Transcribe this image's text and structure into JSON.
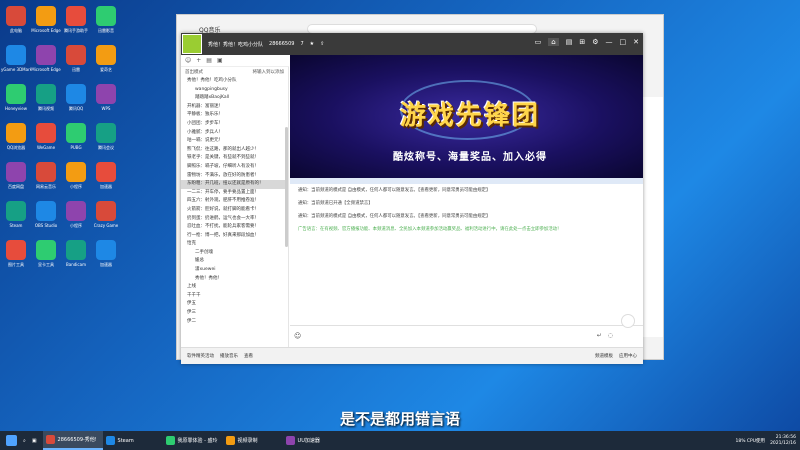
{
  "desktop": {
    "icons": [
      [
        "此电脑",
        "yGame 3DMark",
        "Honeyview",
        "QQ浏览器",
        "百度网盘",
        "Steam",
        "图片工具"
      ],
      [
        "Microsoft Edge",
        "Microsoft Edge",
        "腾讯视频",
        "WeGame",
        "网易云音乐",
        "OBS Studio",
        "显卡工具"
      ],
      [
        "腾讯手游助手",
        "迅雷",
        "腾讯QQ",
        "PUBG",
        "小程序",
        "小程序",
        "Bandicam"
      ],
      [
        "迅雷影音",
        "爱奇艺",
        "WPS",
        "腾讯会议",
        "加速器",
        "Crazy Game",
        "加速器"
      ]
    ]
  },
  "bg_window": {
    "tab": "QQ音乐"
  },
  "qq": {
    "title": "秀他！秀他！吃鸡小分队",
    "group_id": "28666509",
    "members": "7",
    "list_header": "首出模式",
    "list_link": "将输入到以添加",
    "rows": [
      {
        "text": "秀他！秀他！吃鸡小分队",
        "sel": false,
        "sub": false
      },
      {
        "text": "wangpingbusy",
        "sel": false,
        "sub": true
      },
      {
        "text": "踏踏踏xBaojKall",
        "sel": false,
        "sub": true
      },
      {
        "text": "开机器：富丽迷！",
        "sel": false,
        "sub": false
      },
      {
        "text": "平静板：独乐乐！",
        "sel": false,
        "sub": false
      },
      {
        "text": "小团团：步步车！",
        "sel": false,
        "sub": false
      },
      {
        "text": "小雅腻：步兵人！",
        "sel": false,
        "sub": false
      },
      {
        "text": "咕一嗝：说更元！",
        "sel": false,
        "sub": false
      },
      {
        "text": "熊飞侃：往这路，那的就出人越少！",
        "sel": false,
        "sub": false
      },
      {
        "text": "铁老乎：是关键，有些就不到些就！",
        "sel": false,
        "sub": false
      },
      {
        "text": "脚照乐：嗝子坡，仔细听人有没有！",
        "sel": false,
        "sub": false
      },
      {
        "text": "雷物坊：不满乐，放在好的防患者！",
        "sel": false,
        "sub": false
      },
      {
        "text": "东盼粗：开几班，扭以还就是原有的！",
        "sel": true,
        "sub": false
      },
      {
        "text": "一二三：开车停，要手要品置上面！",
        "sel": false,
        "sub": false
      },
      {
        "text": "四五六：射外观，肥肝不用推卷准！",
        "sel": false,
        "sub": false
      },
      {
        "text": "火箭箭：腔好说，就打脚的能看卡！",
        "sel": false,
        "sub": false
      },
      {
        "text": "扔到蛋：扔进鹤，运气也会一大率！",
        "sel": false,
        "sub": false
      },
      {
        "text": "忍吐血：不打扰，能轮兵家客需要！",
        "sel": false,
        "sub": false
      },
      {
        "text": "行一枪：博一把，好真来那段加血！",
        "sel": false,
        "sub": false
      },
      {
        "text": "恰克",
        "sel": false,
        "sub": false
      },
      {
        "text": "二手创魂",
        "sel": false,
        "sub": true
      },
      {
        "text": "媛总",
        "sel": false,
        "sub": true
      },
      {
        "text": "潇xuewei",
        "sel": false,
        "sub": true
      },
      {
        "text": "秀他！秀他！",
        "sel": false,
        "sub": true
      },
      {
        "text": "上线",
        "sel": false,
        "sub": false
      },
      {
        "text": "千千千",
        "sel": false,
        "sub": false
      },
      {
        "text": "伊五",
        "sel": false,
        "sub": false
      },
      {
        "text": "伊三",
        "sel": false,
        "sub": false
      },
      {
        "text": "伊二",
        "sel": false,
        "sub": false
      }
    ],
    "banner_title": "游戏先锋团",
    "banner_sub": "酷炫称号、海量奖品、加入必得",
    "messages": [
      {
        "text": "通知：当前频道的模式是 自由模式，任何人都可以随意发言。【查看更新，同意常勇员可能由规定】",
        "green": false
      },
      {
        "text": "通知：当前频道已开通【全频道禁言】",
        "green": false
      },
      {
        "text": "通知：当前频道的模式是 自由模式，任何人都可以随意发言。【查看更新，同意常勇员可能由规定】",
        "green": false
      },
      {
        "text": "广告语言：在有视频、官方播报功能、本频道消息、全民加入本频道参加活动赢奖品、福利活动进行中，请在此处一点击立即参加活动！",
        "green": true
      }
    ],
    "bottom": [
      {
        "label": "软件精英活动"
      },
      {
        "label": "播放音乐"
      },
      {
        "label": "查看"
      }
    ],
    "bottom_right": [
      "频道模板",
      "应用中心"
    ]
  },
  "subtitle": "是不是都用错言语",
  "taskbar": {
    "apps": [
      "28666509-秀他!",
      "Steam",
      "我原罪体验 - 盛玲",
      "视频录制",
      "UU加速器"
    ],
    "cpu": "18% CPU使用",
    "time": "21:36:56",
    "date": "2021/12/16"
  }
}
